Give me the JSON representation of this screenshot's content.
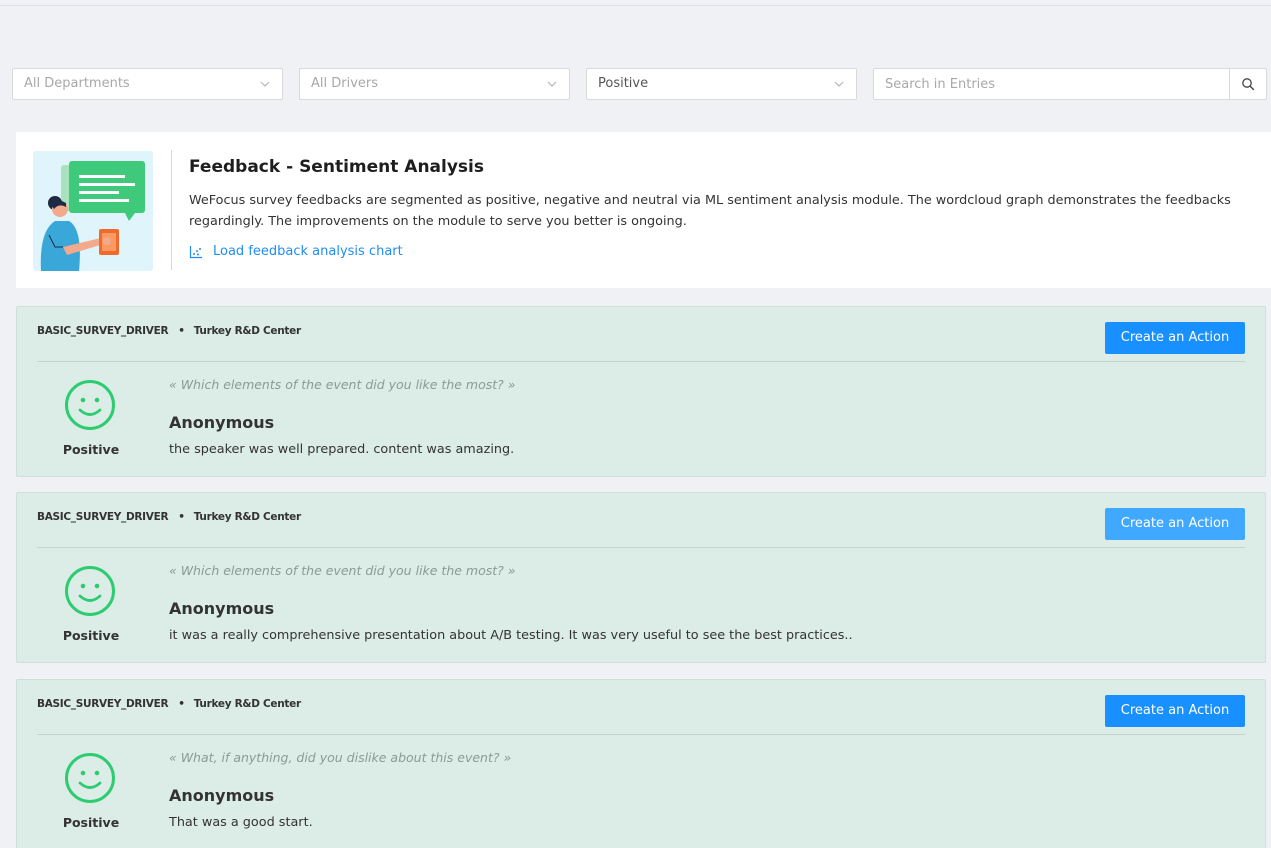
{
  "filters": {
    "department": "All Departments",
    "driver": "All Drivers",
    "sentiment": "Positive",
    "search_placeholder": "Search in Entries"
  },
  "info": {
    "title": "Feedback - Sentiment Analysis",
    "description": "WeFocus survey feedbacks are segmented as positive, negative and neutral via ML sentiment analysis module. The wordcloud graph demonstrates the feedbacks regardingly. The improvements on the module to serve you better is ongoing.",
    "link": "Load feedback analysis chart"
  },
  "entries": [
    {
      "driver": "BASIC_SURVEY_DRIVER",
      "department": "Turkey R&D Center",
      "action_label": "Create an Action",
      "sentiment": "Positive",
      "question": "« Which elements of the event did you like the most? »",
      "author": "Anonymous",
      "answer": "the speaker was well prepared. content was amazing."
    },
    {
      "driver": "BASIC_SURVEY_DRIVER",
      "department": "Turkey R&D Center",
      "action_label": "Create an Action",
      "sentiment": "Positive",
      "question": "« Which elements of the event did you like the most? »",
      "author": "Anonymous",
      "answer": "it was a really comprehensive presentation about A/B testing. It was very useful to see the best practices.."
    },
    {
      "driver": "BASIC_SURVEY_DRIVER",
      "department": "Turkey R&D Center",
      "action_label": "Create an Action",
      "sentiment": "Positive",
      "question": "« What, if anything, did you dislike about this event? »",
      "author": "Anonymous",
      "answer": "That was a good start."
    }
  ],
  "colors": {
    "primary": "#1890ff",
    "primary_hover": "#40a9ff",
    "positive": "#2ecc71",
    "entry_background": "#dcece6",
    "link": "#1f8ef1"
  },
  "icons": {
    "dropdown": "chevron-down-icon",
    "search": "search-icon",
    "chart": "chart-icon",
    "sentiment": "smiley-icon"
  }
}
